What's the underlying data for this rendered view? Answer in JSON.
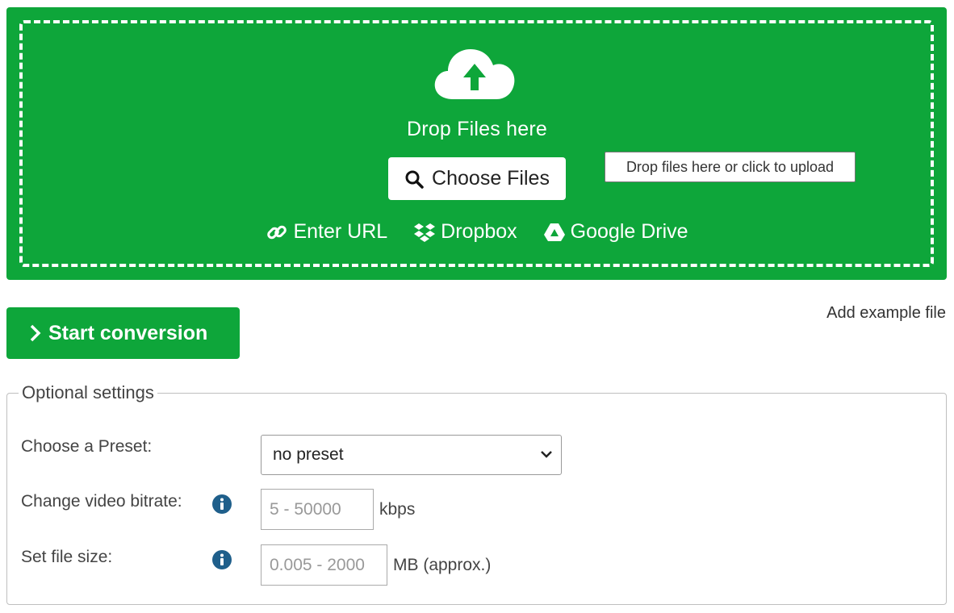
{
  "dropzone": {
    "title": "Drop Files here",
    "choose_label": "Choose Files",
    "tooltip": "Drop files here or click to upload",
    "sources": [
      {
        "label": "Enter URL",
        "icon": "link-icon"
      },
      {
        "label": "Dropbox",
        "icon": "dropbox-icon"
      },
      {
        "label": "Google Drive",
        "icon": "google-drive-icon"
      }
    ],
    "bg_color": "#0ea63a"
  },
  "actions": {
    "start_label": "Start conversion",
    "add_example": "Add example file"
  },
  "settings": {
    "legend": "Optional settings",
    "preset_label": "Choose a Preset:",
    "preset_value": "no preset",
    "bitrate_label": "Change video bitrate:",
    "bitrate_placeholder": "5 - 50000",
    "bitrate_unit": "kbps",
    "filesize_label": "Set file size:",
    "filesize_placeholder": "0.005 - 2000",
    "filesize_unit": "MB (approx.)"
  }
}
